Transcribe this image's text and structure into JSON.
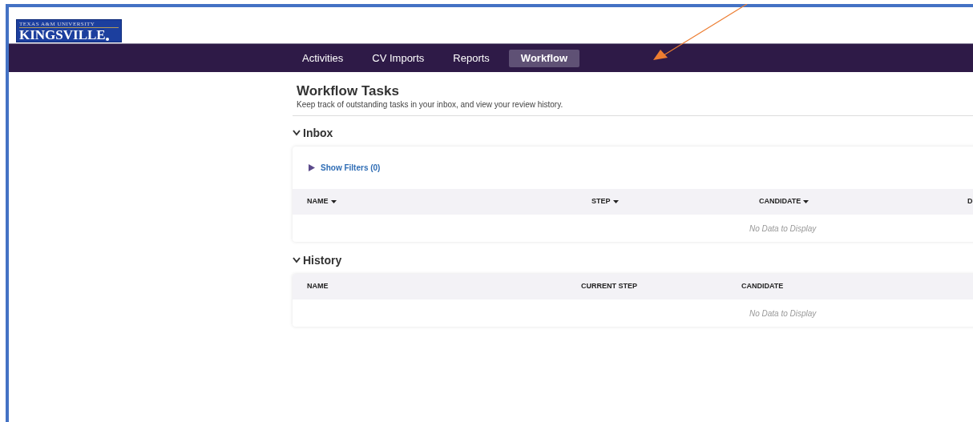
{
  "logo": {
    "top_line": "TEXAS A&M UNIVERSITY",
    "name": "KINGSVILLE"
  },
  "tabs": [
    {
      "label": "Activities",
      "selected": false
    },
    {
      "label": "CV Imports",
      "selected": false
    },
    {
      "label": "Reports",
      "selected": false
    },
    {
      "label": "Workflow",
      "selected": true
    }
  ],
  "page": {
    "title": "Workflow Tasks",
    "subtitle": "Keep track of outstanding tasks in your inbox, and view your review history."
  },
  "sections": [
    {
      "title": "Inbox",
      "expanded": true,
      "filters_link": "Show Filters (0)",
      "columns": [
        {
          "label": "NAME",
          "sortable": true
        },
        {
          "label": "STEP",
          "sortable": true
        },
        {
          "label": "CANDIDATE",
          "sortable": true
        },
        {
          "label": "D",
          "sortable": false
        }
      ],
      "empty_text": "No Data to Display"
    },
    {
      "title": "History",
      "expanded": true,
      "columns": [
        {
          "label": "NAME",
          "sortable": false
        },
        {
          "label": "CURRENT STEP",
          "sortable": false
        },
        {
          "label": "CANDIDATE",
          "sortable": false
        }
      ],
      "empty_text": "No Data to Display"
    }
  ]
}
